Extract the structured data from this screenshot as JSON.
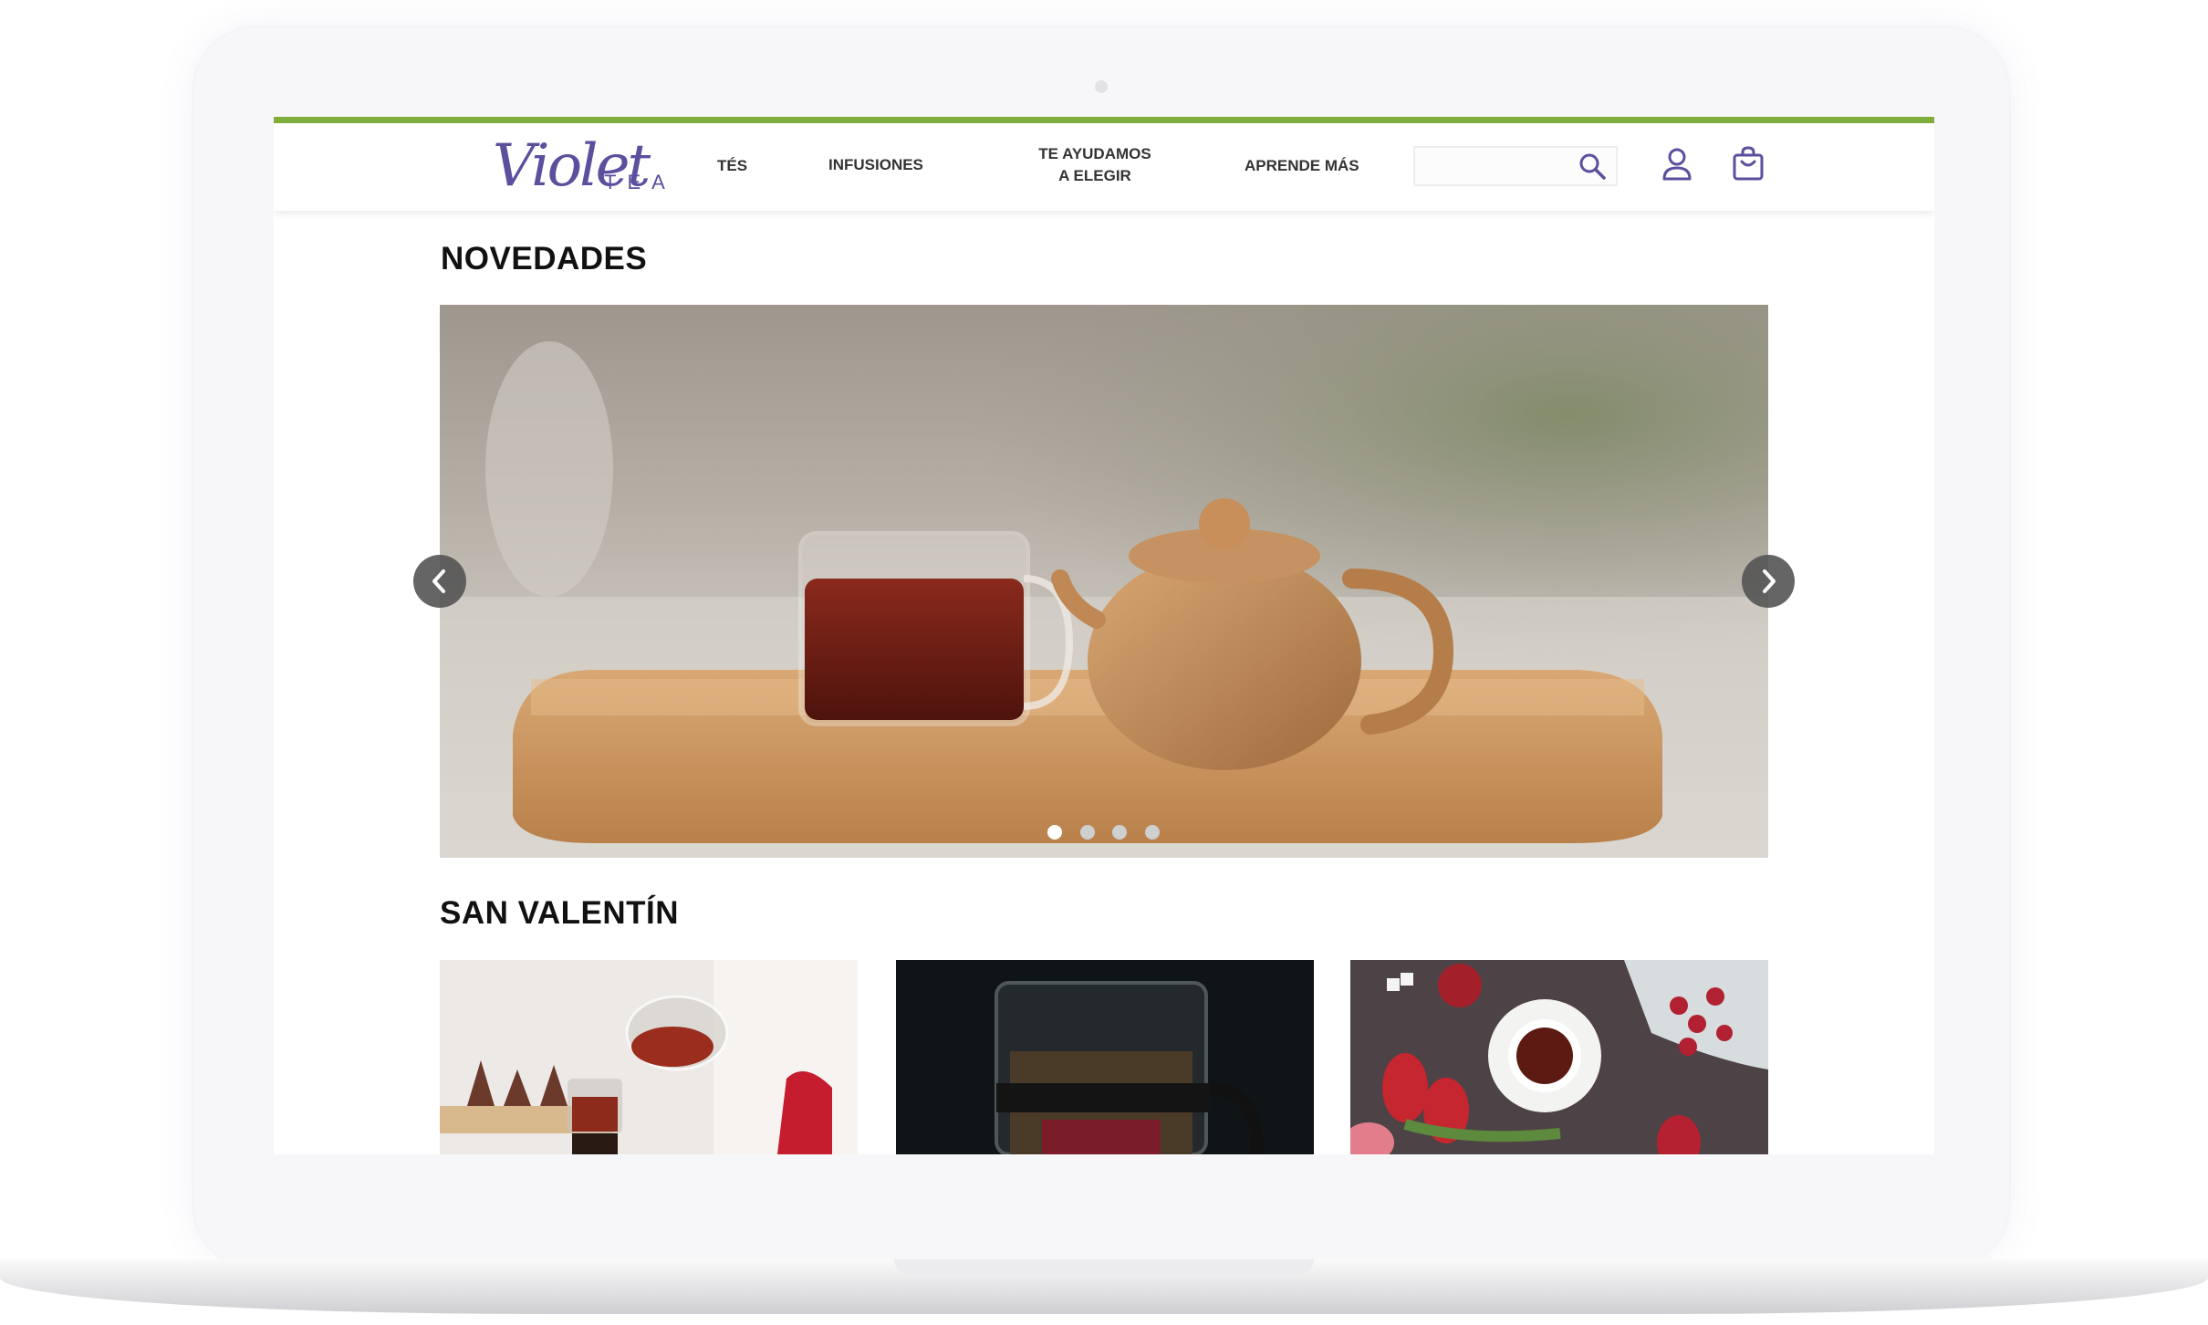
{
  "brand": {
    "name_script": "Violet",
    "name_suffix": "TEA",
    "color": "#5b4f9e",
    "accent": "#7fae3e"
  },
  "nav": {
    "items": [
      {
        "label": "TÉS"
      },
      {
        "label": "INFUSIONES"
      },
      {
        "label_line1": "TE AYUDAMOS",
        "label_line2": "A ELEGIR"
      },
      {
        "label": "APRENDE MÁS"
      }
    ]
  },
  "search": {
    "value": "",
    "icon": "search-icon"
  },
  "icons": {
    "account": "user-icon",
    "cart": "shopping-bag-icon"
  },
  "sections": {
    "novedades": {
      "title": "NOVEDADES"
    },
    "san_valentin": {
      "title": "SAN VALENTÍN"
    }
  },
  "carousel": {
    "slide_count": 4,
    "active_slide": 1,
    "image": "tea glass and clay teapot on wooden tray"
  },
  "tiles": [
    {
      "image": "teapot pouring red tea"
    },
    {
      "image": "french press with tea, dark background"
    },
    {
      "image": "cup of tea with tulips and raspberries"
    }
  ]
}
